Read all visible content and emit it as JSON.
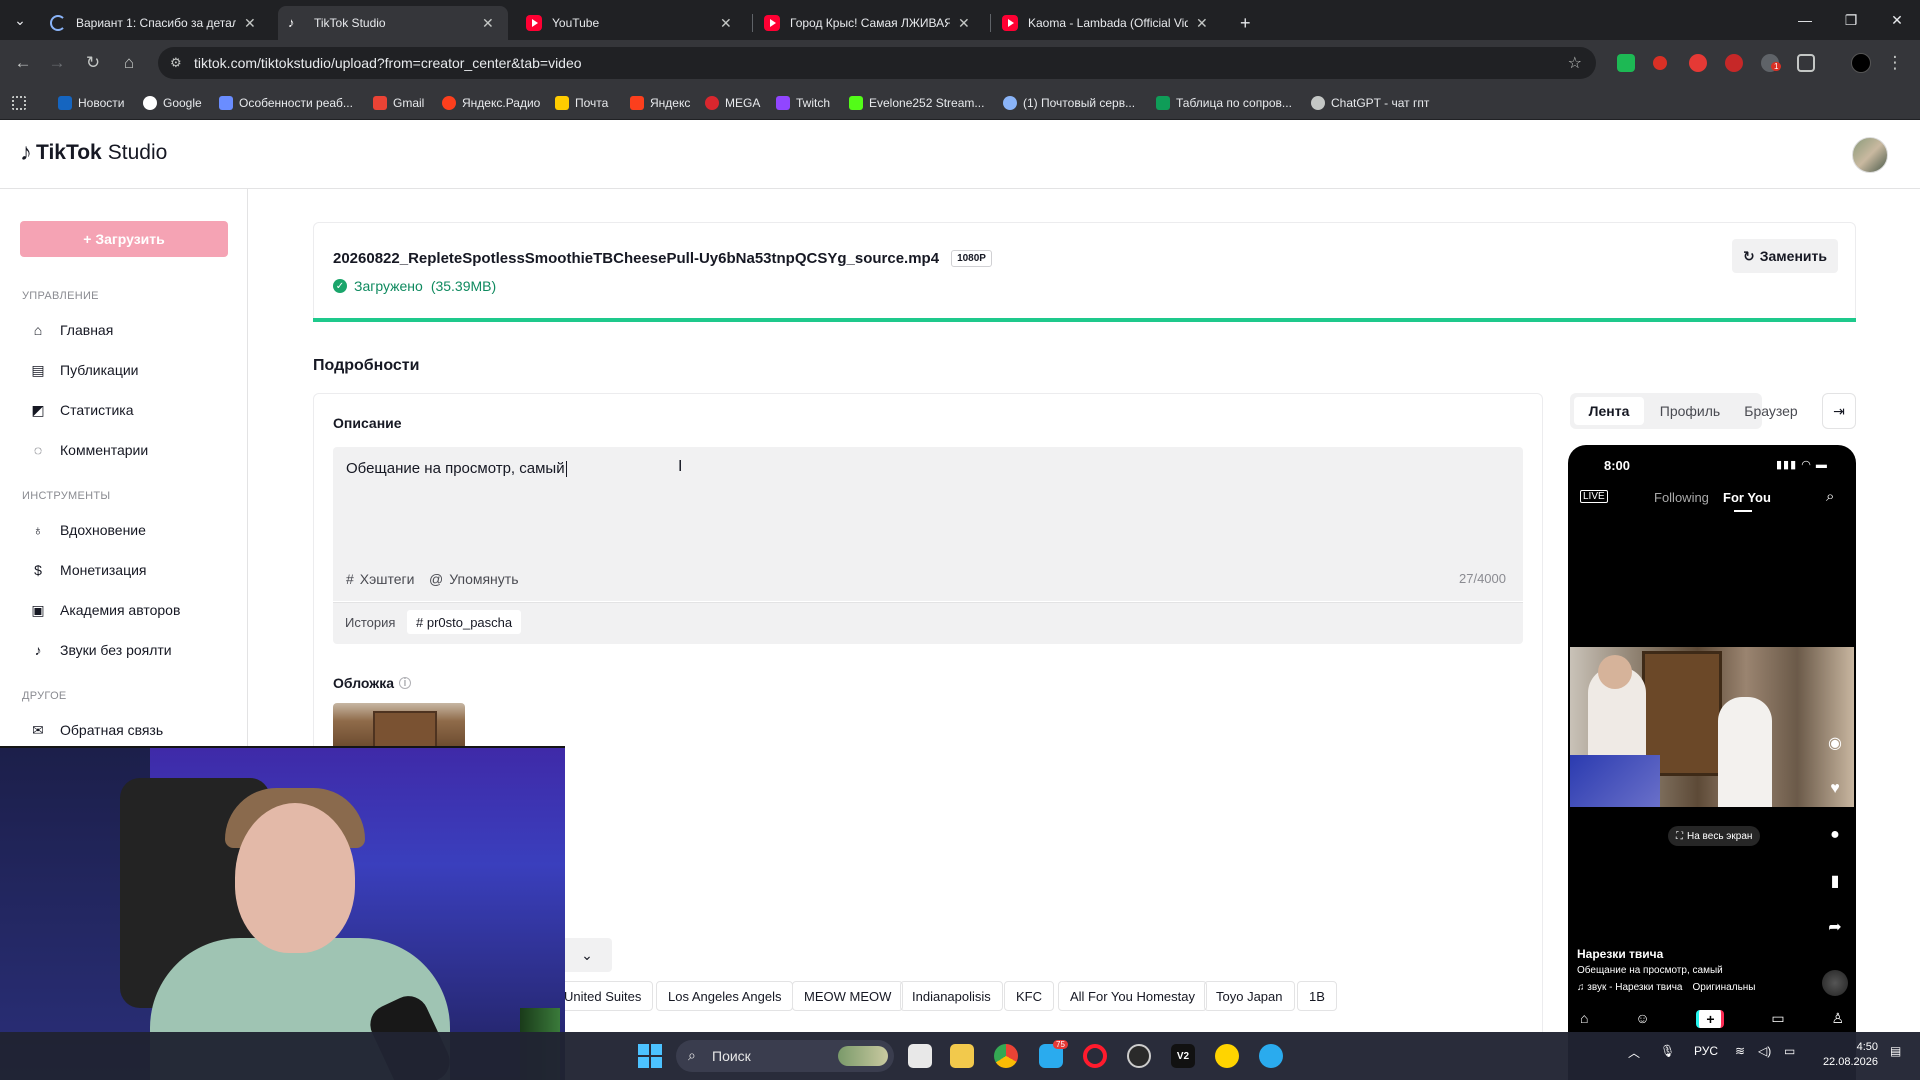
{
  "browser": {
    "tabs": [
      {
        "label": "Вариант 1: Спасибо за детали",
        "icon": "loading-icon"
      },
      {
        "label": "TikTok Studio",
        "icon": "tiktok-icon"
      },
      {
        "label": "YouTube",
        "icon": "youtube-icon"
      },
      {
        "label": "Город Крыс! Самая ЛЖИВАЯ",
        "icon": "youtube-icon"
      },
      {
        "label": "Kaoma - Lambada (Official Vide",
        "icon": "youtube-icon"
      }
    ],
    "new_tab": "+",
    "url": "tiktok.com/tiktokstudio/upload?from=creator_center&tab=video",
    "bookmarks": [
      "Новости",
      "Google",
      "Особенности реаб...",
      "Gmail",
      "Яндекс.Радио",
      "Почта",
      "Яндекс",
      "MEGA",
      "Twitch",
      "Evelone252 Stream...",
      "(1) Почтовый серв...",
      "Таблица по сопров...",
      "ChatGPT - чат гпт"
    ],
    "extension_badge": "1"
  },
  "header": {
    "logo_brand": "TikTok",
    "logo_product": "Studio"
  },
  "sidebar": {
    "upload_label": "+ Загрузить",
    "sections": [
      {
        "label": "УПРАВЛЕНИЕ",
        "items": [
          "Главная",
          "Публикации",
          "Статистика",
          "Комментарии"
        ]
      },
      {
        "label": "ИНСТРУМЕНТЫ",
        "items": [
          "Вдохновение",
          "Монетизация",
          "Академия авторов",
          "Звуки без роялти"
        ]
      },
      {
        "label": "ДРУГОЕ",
        "items": [
          "Обратная связь"
        ]
      }
    ]
  },
  "file": {
    "name": "20260822_RepleteSpotlessSmoothieTBCheesePull-Uy6bNa53tnpQCSYg_source.mp4",
    "resolution": "1080P",
    "status": "Загружено",
    "size": "(35.39MB)",
    "replace_label": "Заменить",
    "progress": 1.0
  },
  "details": {
    "title": "Подробности",
    "description_label": "Описание",
    "description_text": "Обещание на просмотр, самый",
    "hashtags_label": "Хэштеги",
    "mention_label": "Упомянуть",
    "counter": "27/4000",
    "history_label": "История",
    "history_chip": "# pr0sto_pascha",
    "cover_label": "Обложка",
    "location_chips": [
      "United Suites",
      "Los Angeles Angels",
      "MEOW MEOW",
      "Indianapolisis",
      "KFC",
      "All For You Homestay",
      "Toyo Japan",
      "1B"
    ]
  },
  "preview": {
    "tabs": [
      "Лента",
      "Профиль",
      "Браузер"
    ],
    "time": "8:00",
    "live": "LIVE",
    "following": "Following",
    "for_you": "For You",
    "fullscreen": "На весь экран",
    "author": "Нарезки твича",
    "caption": "Обещание на просмотр, самый",
    "sound": "♫ звук - Нарезки твича",
    "sound_original": "Оригинальны"
  },
  "taskbar": {
    "search_placeholder": "Поиск",
    "language": "РУС",
    "time": "4:50",
    "date": "22.08.2026",
    "telegram_badge": "75"
  },
  "colors": {
    "accent": "#fe2c55",
    "upload_button": "#f5a3b4",
    "success": "#1ec98c"
  }
}
